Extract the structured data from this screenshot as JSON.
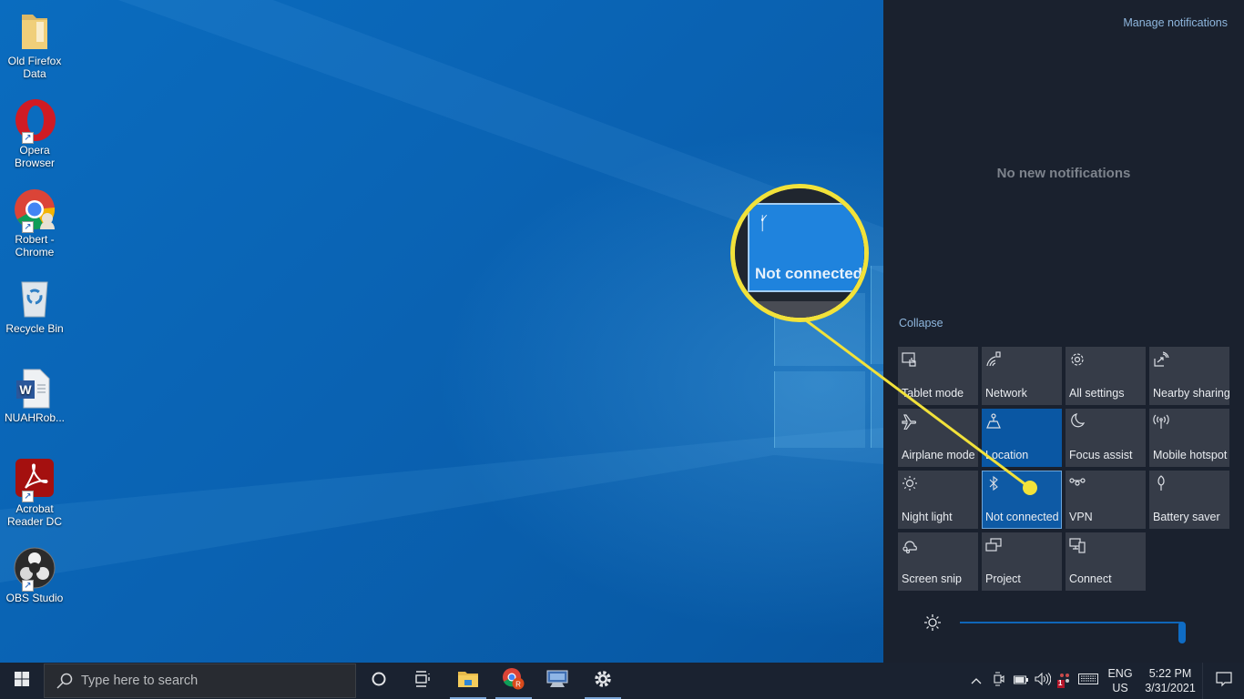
{
  "desktop": {
    "icons": [
      {
        "label": "Old Firefox Data",
        "icon": "folder-icon",
        "shortcut": false
      },
      {
        "label": "Opera Browser",
        "icon": "opera-icon",
        "shortcut": true
      },
      {
        "label": "Robert - Chrome",
        "icon": "chrome-icon",
        "shortcut": true
      },
      {
        "label": "Recycle Bin",
        "icon": "recycle-bin-icon",
        "shortcut": false
      },
      {
        "label": "NUAHRob...",
        "icon": "word-document-icon",
        "shortcut": false
      },
      {
        "label": "Acrobat Reader DC",
        "icon": "acrobat-icon",
        "shortcut": true
      },
      {
        "label": "OBS Studio",
        "icon": "obs-icon",
        "shortcut": true
      }
    ]
  },
  "action_center": {
    "manage_notifications": "Manage notifications",
    "no_notifications": "No new notifications",
    "collapse": "Collapse",
    "quick_actions": [
      {
        "label": "Tablet mode",
        "icon": "tablet-mode-icon",
        "state": "off"
      },
      {
        "label": "Network",
        "icon": "network-icon",
        "state": "off"
      },
      {
        "label": "All settings",
        "icon": "gear-icon",
        "state": "off"
      },
      {
        "label": "Nearby sharing",
        "icon": "nearby-sharing-icon",
        "state": "off"
      },
      {
        "label": "Airplane mode",
        "icon": "airplane-icon",
        "state": "off"
      },
      {
        "label": "Location",
        "icon": "location-icon",
        "state": "on"
      },
      {
        "label": "Focus assist",
        "icon": "moon-icon",
        "state": "off"
      },
      {
        "label": "Mobile hotspot",
        "icon": "hotspot-icon",
        "state": "off"
      },
      {
        "label": "Night light",
        "icon": "night-light-icon",
        "state": "off"
      },
      {
        "label": "Not connected",
        "icon": "bluetooth-icon",
        "state": "on"
      },
      {
        "label": "VPN",
        "icon": "vpn-icon",
        "state": "off"
      },
      {
        "label": "Battery saver",
        "icon": "battery-saver-icon",
        "state": "off"
      },
      {
        "label": "Screen snip",
        "icon": "screen-snip-icon",
        "state": "off"
      },
      {
        "label": "Project",
        "icon": "project-icon",
        "state": "off"
      },
      {
        "label": "Connect",
        "icon": "connect-icon",
        "state": "off"
      }
    ],
    "brightness_percent": 100,
    "accent_color": "#0a57a3"
  },
  "callout": {
    "label": "Not connected",
    "icon": "bluetooth-icon",
    "color": "#f2e23a"
  },
  "taskbar": {
    "search_placeholder": "Type here to search",
    "pinned": [
      {
        "name": "cortana",
        "icon": "cortana-circle-icon",
        "running": false
      },
      {
        "name": "task-view",
        "icon": "task-view-icon",
        "running": false
      },
      {
        "name": "file-explorer",
        "icon": "file-explorer-icon",
        "running": true
      },
      {
        "name": "chrome",
        "icon": "chrome-profile-icon",
        "running": true
      },
      {
        "name": "remote-desktop",
        "icon": "remote-desktop-icon",
        "running": false
      },
      {
        "name": "settings",
        "icon": "gear-icon",
        "running": true
      }
    ],
    "tray": {
      "language_top": "ENG",
      "language_bottom": "US",
      "time": "5:22 PM",
      "date": "3/31/2021",
      "badge_count": "1"
    }
  }
}
